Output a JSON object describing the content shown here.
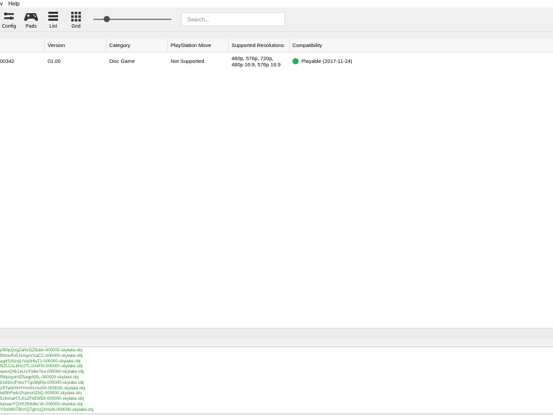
{
  "menubar": {
    "items": [
      "v",
      "Help"
    ]
  },
  "toolbar": {
    "buttons": [
      {
        "label": "Config",
        "icon": "config-icon"
      },
      {
        "label": "Pads",
        "icon": "gamepad-icon"
      },
      {
        "label": "List",
        "icon": "list-icon"
      },
      {
        "label": "Grid",
        "icon": "grid-icon"
      }
    ],
    "zoom_slider_fraction": 0.17,
    "search_placeholder": "Search..."
  },
  "table": {
    "headers": [
      "",
      "Version",
      "Category",
      "PlayStation Move",
      "Supported Resolutions",
      "Compatibility"
    ],
    "rows": [
      {
        "serial": "00342",
        "version": "01.00",
        "category": "Disc Game",
        "move": "Not Supported",
        "resolutions": "480p, 576p, 720p, 480p 16:9, 576p 16:9",
        "compat_status": "Playable (2017-11-24)",
        "compat_color": "#27ae60"
      }
    ]
  },
  "log": {
    "color": "#2e8b2e",
    "lines": [
      "pf90pQvgZaNvGZ8ukh-000000-skylake.obj",
      "fthmuRv0JxAqsVXaCC-000000-skylake.obj",
      "agdSzbzxjLrVa3HtvT1-000000-skylake.obj",
      "NZLCsLbHc2TL1GkFN-000000-skylake.obj",
      "xpxoQXk1eUvrFp6e7eu-000000-skylake.obj",
      "f56pzgun0Z5aqpNXL-000000-skylake.obj",
      "8169oUFhvsYTgcMpRp-000000-skylake.obj",
      "uRTahtXKHYmr91muSH-000000-skylake.obj",
      "iw0thFwb1Pcpoo0ZbQ-000000-skylake.obj",
      "5UtnnaH7LKsZFbEM59-000000-skylake.obj",
      "bjsoauYQXK2K8dbc1K-000000-skylake.obj",
      "YSmW0TBnYQ7gH1QXmuN-000000-skylake.obj"
    ]
  }
}
